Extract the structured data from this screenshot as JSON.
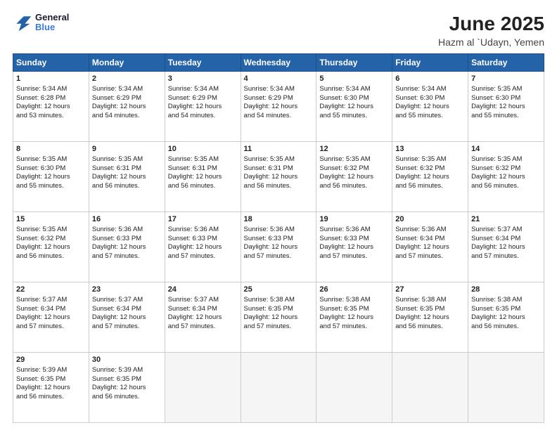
{
  "logo": {
    "line1": "General",
    "line2": "Blue"
  },
  "title": "June 2025",
  "location": "Hazm al `Udayn, Yemen",
  "weekdays": [
    "Sunday",
    "Monday",
    "Tuesday",
    "Wednesday",
    "Thursday",
    "Friday",
    "Saturday"
  ],
  "weeks": [
    [
      {
        "day": 1,
        "rise": "5:34 AM",
        "set": "6:28 PM",
        "hours": "12 hours and 53 minutes."
      },
      {
        "day": 2,
        "rise": "5:34 AM",
        "set": "6:29 PM",
        "hours": "12 hours and 54 minutes."
      },
      {
        "day": 3,
        "rise": "5:34 AM",
        "set": "6:29 PM",
        "hours": "12 hours and 54 minutes."
      },
      {
        "day": 4,
        "rise": "5:34 AM",
        "set": "6:29 PM",
        "hours": "12 hours and 54 minutes."
      },
      {
        "day": 5,
        "rise": "5:34 AM",
        "set": "6:30 PM",
        "hours": "12 hours and 55 minutes."
      },
      {
        "day": 6,
        "rise": "5:34 AM",
        "set": "6:30 PM",
        "hours": "12 hours and 55 minutes."
      },
      {
        "day": 7,
        "rise": "5:35 AM",
        "set": "6:30 PM",
        "hours": "12 hours and 55 minutes."
      }
    ],
    [
      {
        "day": 8,
        "rise": "5:35 AM",
        "set": "6:30 PM",
        "hours": "12 hours and 55 minutes."
      },
      {
        "day": 9,
        "rise": "5:35 AM",
        "set": "6:31 PM",
        "hours": "12 hours and 56 minutes."
      },
      {
        "day": 10,
        "rise": "5:35 AM",
        "set": "6:31 PM",
        "hours": "12 hours and 56 minutes."
      },
      {
        "day": 11,
        "rise": "5:35 AM",
        "set": "6:31 PM",
        "hours": "12 hours and 56 minutes."
      },
      {
        "day": 12,
        "rise": "5:35 AM",
        "set": "6:32 PM",
        "hours": "12 hours and 56 minutes."
      },
      {
        "day": 13,
        "rise": "5:35 AM",
        "set": "6:32 PM",
        "hours": "12 hours and 56 minutes."
      },
      {
        "day": 14,
        "rise": "5:35 AM",
        "set": "6:32 PM",
        "hours": "12 hours and 56 minutes."
      }
    ],
    [
      {
        "day": 15,
        "rise": "5:35 AM",
        "set": "6:32 PM",
        "hours": "12 hours and 56 minutes."
      },
      {
        "day": 16,
        "rise": "5:36 AM",
        "set": "6:33 PM",
        "hours": "12 hours and 57 minutes."
      },
      {
        "day": 17,
        "rise": "5:36 AM",
        "set": "6:33 PM",
        "hours": "12 hours and 57 minutes."
      },
      {
        "day": 18,
        "rise": "5:36 AM",
        "set": "6:33 PM",
        "hours": "12 hours and 57 minutes."
      },
      {
        "day": 19,
        "rise": "5:36 AM",
        "set": "6:33 PM",
        "hours": "12 hours and 57 minutes."
      },
      {
        "day": 20,
        "rise": "5:36 AM",
        "set": "6:34 PM",
        "hours": "12 hours and 57 minutes."
      },
      {
        "day": 21,
        "rise": "5:37 AM",
        "set": "6:34 PM",
        "hours": "12 hours and 57 minutes."
      }
    ],
    [
      {
        "day": 22,
        "rise": "5:37 AM",
        "set": "6:34 PM",
        "hours": "12 hours and 57 minutes."
      },
      {
        "day": 23,
        "rise": "5:37 AM",
        "set": "6:34 PM",
        "hours": "12 hours and 57 minutes."
      },
      {
        "day": 24,
        "rise": "5:37 AM",
        "set": "6:34 PM",
        "hours": "12 hours and 57 minutes."
      },
      {
        "day": 25,
        "rise": "5:38 AM",
        "set": "6:35 PM",
        "hours": "12 hours and 57 minutes."
      },
      {
        "day": 26,
        "rise": "5:38 AM",
        "set": "6:35 PM",
        "hours": "12 hours and 57 minutes."
      },
      {
        "day": 27,
        "rise": "5:38 AM",
        "set": "6:35 PM",
        "hours": "12 hours and 56 minutes."
      },
      {
        "day": 28,
        "rise": "5:38 AM",
        "set": "6:35 PM",
        "hours": "12 hours and 56 minutes."
      }
    ],
    [
      {
        "day": 29,
        "rise": "5:39 AM",
        "set": "6:35 PM",
        "hours": "12 hours and 56 minutes."
      },
      {
        "day": 30,
        "rise": "5:39 AM",
        "set": "6:35 PM",
        "hours": "12 hours and 56 minutes."
      },
      null,
      null,
      null,
      null,
      null
    ]
  ]
}
